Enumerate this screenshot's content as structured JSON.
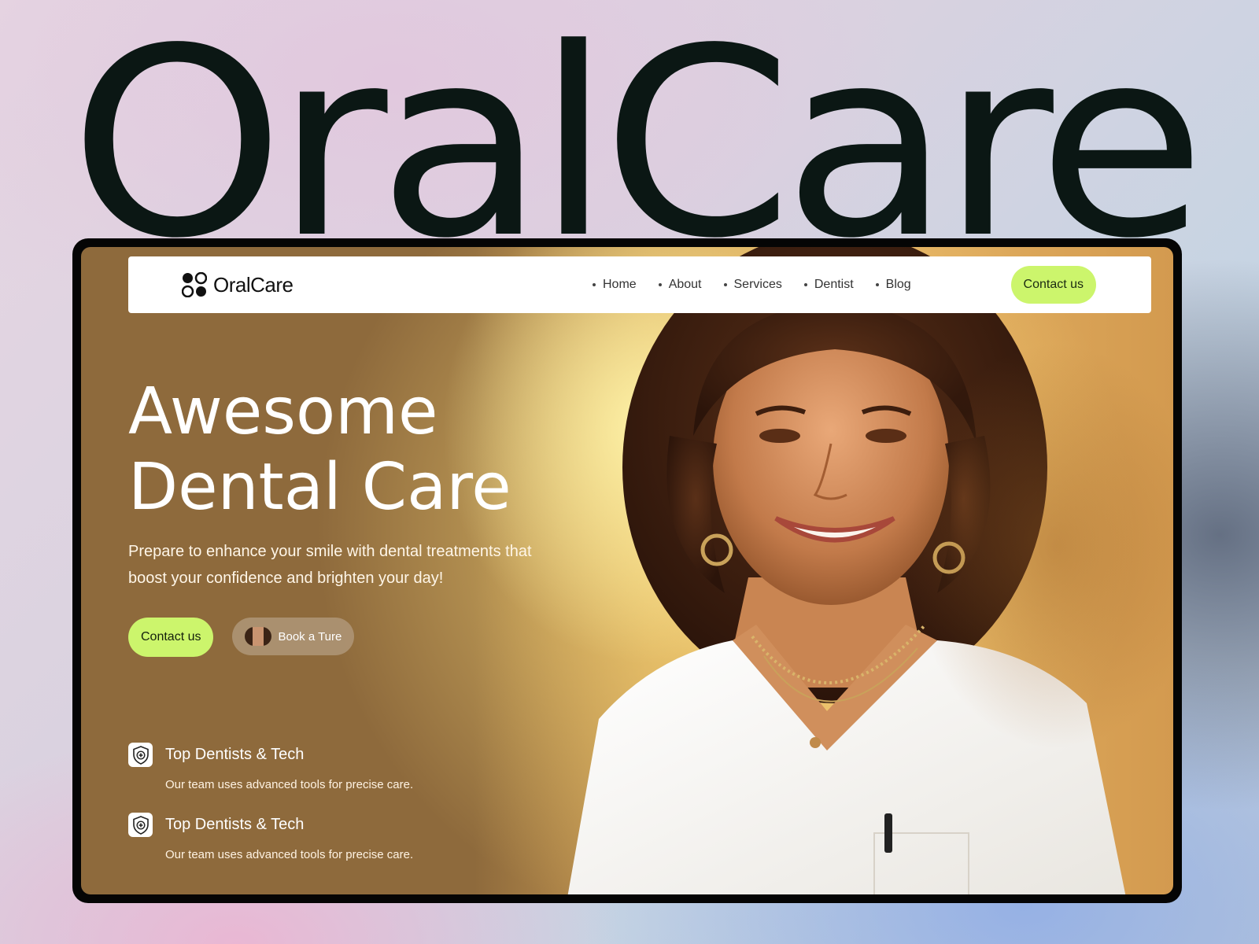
{
  "brand": {
    "big_title": "OralCare",
    "logo_text": "OralCare"
  },
  "nav": {
    "items": [
      {
        "label": "Home"
      },
      {
        "label": "About"
      },
      {
        "label": "Services"
      },
      {
        "label": "Dentist"
      },
      {
        "label": "Blog"
      }
    ],
    "contact_label": "Contact us"
  },
  "hero": {
    "headline_line1": "Awesome",
    "headline_line2": "Dental Care",
    "subtext": "Prepare to enhance your smile with dental treatments that boost your confidence and brighten your day!",
    "primary_cta": "Contact us",
    "secondary_cta": "Book a Ture"
  },
  "features": [
    {
      "title": "Top Dentists & Tech",
      "desc": "Our team uses advanced tools for precise care.",
      "icon": "shield-plus-icon"
    },
    {
      "title": "Top Dentists & Tech",
      "desc": "Our team uses advanced tools for precise care.",
      "icon": "shield-plus-icon"
    }
  ],
  "colors": {
    "accent": "#ccf56c",
    "title_text": "#0b1714",
    "hero_brown": "#8e6a3c"
  }
}
